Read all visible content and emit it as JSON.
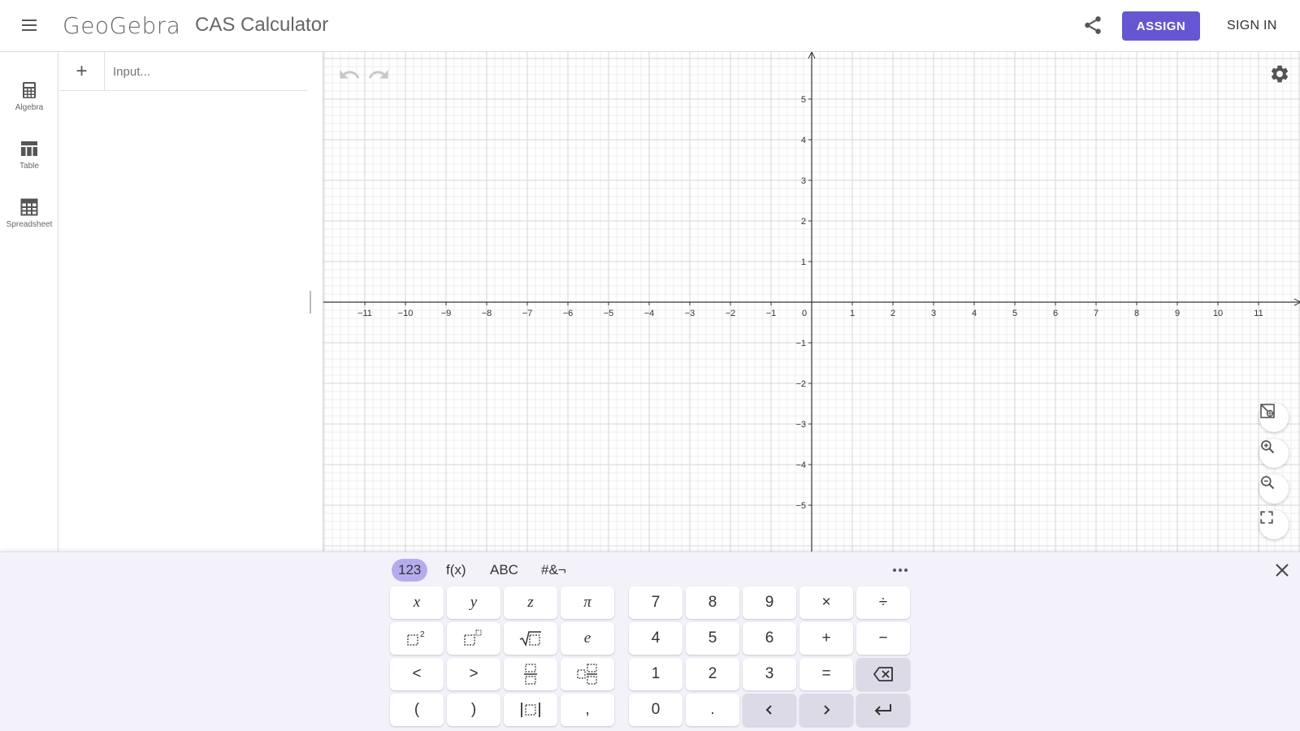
{
  "header": {
    "logo": "GeoGebra",
    "app_title": "CAS Calculator",
    "assign_label": "ASSIGN",
    "signin_label": "SIGN IN",
    "accent_color": "#6557d2"
  },
  "nav": {
    "items": [
      {
        "label": "Algebra",
        "icon": "calculator-icon"
      },
      {
        "label": "Table",
        "icon": "table-icon"
      },
      {
        "label": "Spreadsheet",
        "icon": "spreadsheet-icon"
      }
    ]
  },
  "algebra": {
    "add_label": "+",
    "input_placeholder": "Input..."
  },
  "graphics": {
    "x_range": [
      -11,
      11
    ],
    "y_range": [
      -5,
      5
    ],
    "grid": true,
    "x_tick_labels": [
      "−11",
      "−10",
      "−9",
      "−8",
      "−7",
      "−6",
      "−5",
      "−4",
      "−3",
      "−2",
      "−1",
      "0",
      "1",
      "2",
      "3",
      "4",
      "5",
      "6",
      "7",
      "8",
      "9",
      "10",
      "11"
    ],
    "y_tick_labels": [
      "5",
      "4",
      "3",
      "2",
      "1",
      "−1",
      "−2",
      "−3",
      "−4",
      "−5"
    ],
    "buttons": [
      "undo-icon",
      "redo-icon",
      "gear-icon",
      "standard-view-icon",
      "zoom-in-icon",
      "zoom-out-icon",
      "fullscreen-icon"
    ]
  },
  "keyboard": {
    "tabs": [
      "123",
      "f(x)",
      "ABC",
      "#&¬"
    ],
    "active_tab": "123",
    "left_keys": [
      [
        "x",
        "y",
        "z",
        "π"
      ],
      [
        "square-icon",
        "power-icon",
        "sqrt-icon",
        "e"
      ],
      [
        "<",
        ">",
        "fraction-icon",
        "mixed-fraction-icon"
      ],
      [
        "(",
        ")",
        "abs-icon",
        ","
      ]
    ],
    "right_keys": [
      [
        "7",
        "8",
        "9",
        "×",
        "÷"
      ],
      [
        "4",
        "5",
        "6",
        "+",
        "−"
      ],
      [
        "1",
        "2",
        "3",
        "=",
        "backspace-icon"
      ],
      [
        "0",
        ".",
        "left-arrow-icon",
        "right-arrow-icon",
        "enter-icon"
      ]
    ],
    "active_color": "#b5acef"
  }
}
